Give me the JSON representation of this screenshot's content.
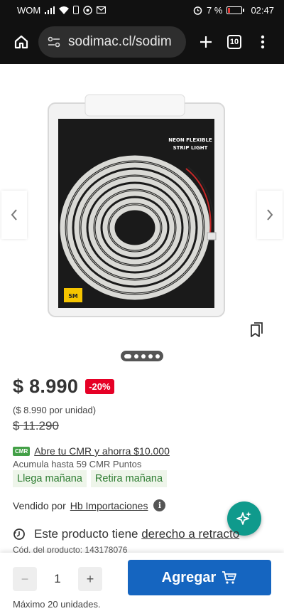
{
  "status_bar": {
    "carrier": "WOM",
    "battery": "7 %",
    "time": "02:47"
  },
  "browser": {
    "url": "sodimac.cl/sodim",
    "tab_count": "10"
  },
  "product_image": {
    "package_text_line1": "NEON FLEXIBLE",
    "package_text_line2": "STRIP LIGHT",
    "size_badge": "5M"
  },
  "gallery": {
    "current_image": 1,
    "total_images": 5
  },
  "price": {
    "current": "$ 8.990",
    "discount": "-20%",
    "unit_price": "($ 8.990 por unidad)",
    "old_price": "$ 11.290"
  },
  "cmr": {
    "logo": "CMR",
    "link": "Abre tu CMR y ahorra $10.000",
    "points": "Acumula hasta 59 CMR Puntos"
  },
  "delivery": {
    "ship": "Llega mañana",
    "pickup": "Retira mañana"
  },
  "seller": {
    "label": "Vendido por",
    "name": "Hb Importaciones"
  },
  "withdraw": {
    "prefix": "Este producto tiene",
    "link": "derecho a retracto"
  },
  "product_code": "Cód. del producto: 143178076",
  "cart": {
    "minus": "−",
    "plus": "+",
    "quantity": "1",
    "add_label": "Agregar",
    "max_units": "Máximo 20 unidades."
  },
  "colors": {
    "primary": "#1565c0",
    "discount": "#e60026",
    "chip_text": "#2e7d32",
    "fab": "#0f9a8c"
  }
}
